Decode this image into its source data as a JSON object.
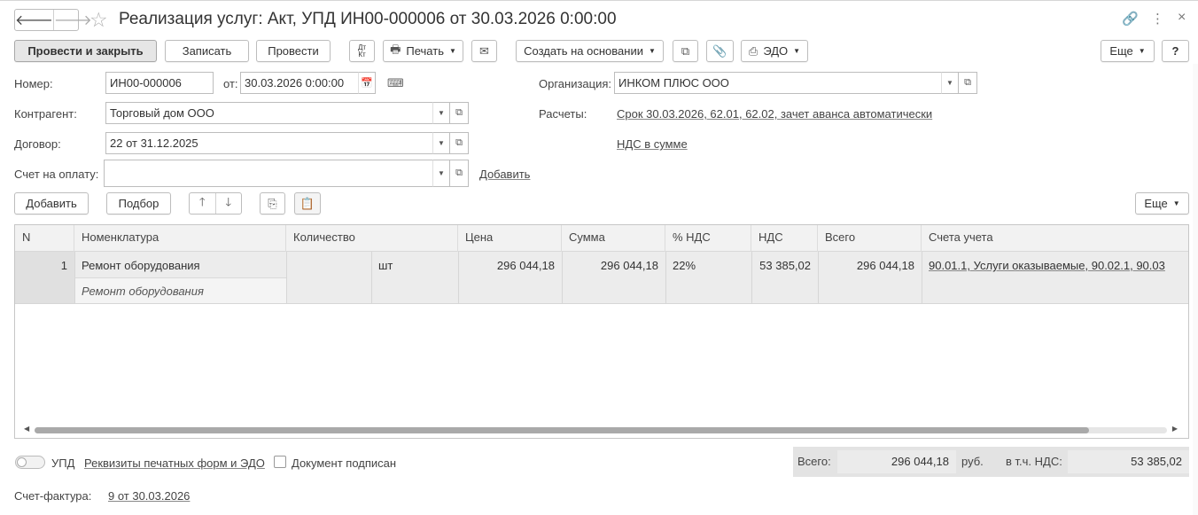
{
  "title": "Реализация услуг: Акт, УПД ИН00-000006 от 30.03.2026 0:00:00",
  "nav": {
    "back": "🡐",
    "forward": "🡒"
  },
  "window_icons": {
    "link": "🔗",
    "more": "⋮",
    "close": "×"
  },
  "toolbar": {
    "post_close": "Провести и закрыть",
    "save": "Записать",
    "post": "Провести",
    "dtkt": "Дт\nКт",
    "print": "Печать",
    "create_based": "Создать на основании",
    "edo": "ЭДО",
    "more": "Еще",
    "help": "?"
  },
  "form": {
    "number_label": "Номер:",
    "number_value": "ИН00-000006",
    "date_label": "от:",
    "date_value": "30.03.2026  0:00:00",
    "org_label": "Организация:",
    "org_value": "ИНКОМ ПЛЮС ООО",
    "contractor_label": "Контрагент:",
    "contractor_value": "Торговый дом ООО",
    "settlements_label": "Расчеты:",
    "settlements_link": "Срок 30.03.2026, 62.01, 62.02, зачет аванса автоматически",
    "contract_label": "Договор:",
    "contract_value": "22 от 31.12.2025",
    "vat_link": "НДС в сумме",
    "invoice_label": "Счет на оплату:",
    "invoice_value": "",
    "invoice_add": "Добавить"
  },
  "table_toolbar": {
    "add": "Добавить",
    "pick": "Подбор",
    "up": "🡑",
    "down": "🡓",
    "more": "Еще"
  },
  "table": {
    "columns": [
      "N",
      "Номенклатура",
      "Количество",
      "Цена",
      "Сумма",
      "% НДС",
      "НДС",
      "Всего",
      "Счета учета"
    ],
    "rows": [
      {
        "n": "1",
        "item": "Ремонт оборудования",
        "item_sub": "Ремонт оборудования",
        "qty": "",
        "unit": "шт",
        "price": "296 044,18",
        "sum": "296 044,18",
        "vat_rate": "22%",
        "vat": "53 385,02",
        "total": "296 044,18",
        "accounts": "90.01.1, Услуги оказываемые, 90.02.1, 90.03"
      }
    ]
  },
  "footer": {
    "upd_label": "УПД",
    "print_requisites": "Реквизиты печатных форм и ЭДО",
    "signed_label": "Документ подписан",
    "total_label": "Всего:",
    "total_value": "296 044,18",
    "currency": "руб.",
    "vat_label": "в т.ч. НДС:",
    "vat_value": "53 385,02",
    "invoice_label": "Счет-фактура:",
    "invoice_link": "9 от 30.03.2026"
  }
}
